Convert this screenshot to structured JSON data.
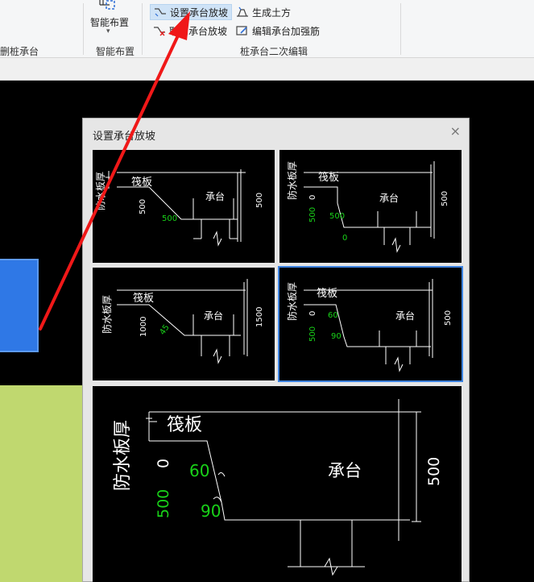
{
  "ribbon": {
    "group1_label": "删桩承台",
    "smart_layout_button": "智能布置",
    "group2_label": "智能布置",
    "set_slope": "设置承台放坡",
    "cancel_slope": "取消承台放坡",
    "gen_earthwork": "生成土方",
    "edit_rebar": "编辑承台加强筋",
    "group3_label": "桩承台二次编辑"
  },
  "dialog": {
    "title": "设置承台放坡",
    "close_glyph": "×",
    "labels": {
      "waterproof": "防水板厚",
      "raft": "筏板",
      "cap": "承台"
    },
    "options": [
      {
        "dims": [
          "500",
          "500"
        ]
      },
      {
        "dims": [
          "0",
          "500",
          "500",
          "0"
        ]
      },
      {
        "dims": [
          "1000",
          "45",
          "1500"
        ]
      },
      {
        "dims": [
          "0",
          "60",
          "500",
          "90",
          "500"
        ]
      }
    ],
    "preview": {
      "dims": [
        "0",
        "60",
        "500",
        "90",
        "500"
      ]
    }
  },
  "colors": {
    "accent": "#3c82e0",
    "dim_green": "#19d219",
    "arrow_red": "#f01818"
  }
}
